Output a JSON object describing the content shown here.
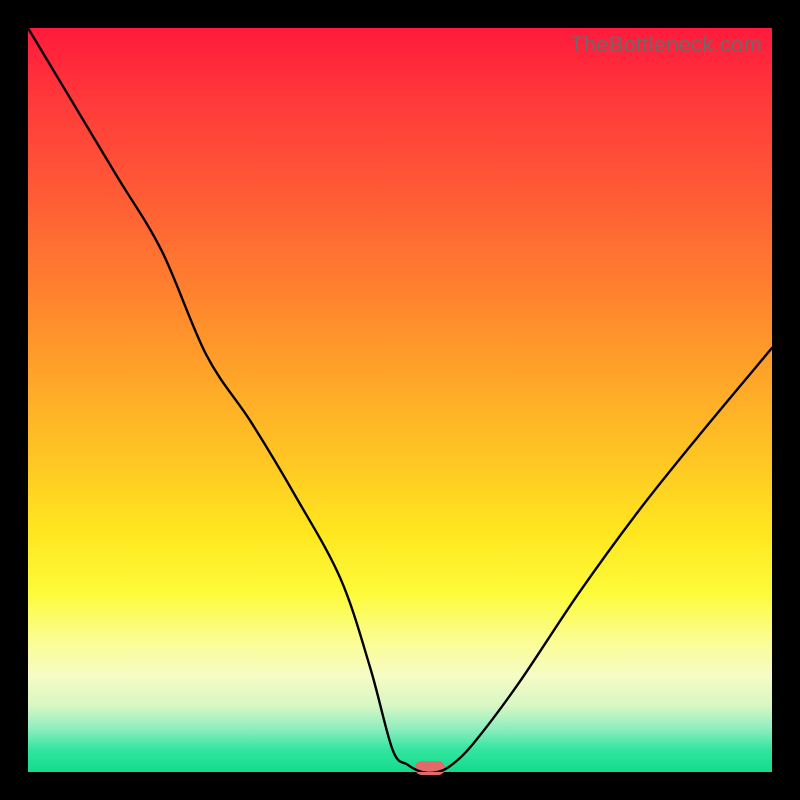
{
  "watermark": "TheBottleneck.com",
  "chart_data": {
    "type": "line",
    "title": "",
    "xlabel": "",
    "ylabel": "",
    "ylim": [
      0,
      100
    ],
    "xlim": [
      0,
      100
    ],
    "series": [
      {
        "name": "bottleneck-curve",
        "x": [
          0,
          6,
          12,
          18,
          24,
          30,
          36,
          42,
          46,
          49,
          51,
          53,
          55,
          57,
          60,
          66,
          74,
          82,
          90,
          100
        ],
        "values": [
          100,
          90,
          80,
          70,
          56,
          47,
          37,
          26,
          14,
          3,
          1,
          0,
          0,
          1,
          4,
          12,
          24,
          35,
          45,
          57
        ]
      }
    ],
    "marker": {
      "x": 54,
      "y": 0.5
    },
    "gradient_stops": [
      {
        "pos": 0,
        "color": "#ff1a3c"
      },
      {
        "pos": 50,
        "color": "#ffb225"
      },
      {
        "pos": 80,
        "color": "#fbfd8e"
      },
      {
        "pos": 100,
        "color": "#12db8c"
      }
    ]
  }
}
